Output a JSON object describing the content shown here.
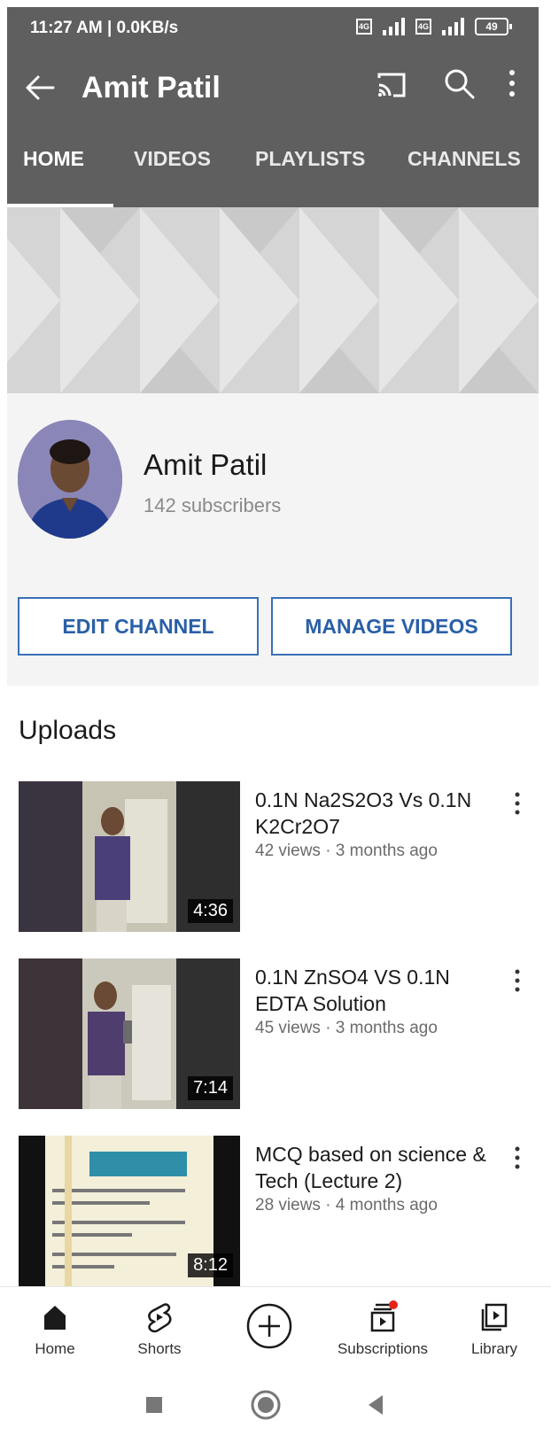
{
  "status_bar": {
    "time": "11:27 AM | 0.0KB/s",
    "battery": "49",
    "sim_label": "4G"
  },
  "app_bar": {
    "title": "Amit Patil",
    "tabs": [
      {
        "label": "HOME",
        "active": true
      },
      {
        "label": "VIDEOS",
        "active": false
      },
      {
        "label": "PLAYLISTS",
        "active": false
      },
      {
        "label": "CHANNELS",
        "active": false
      }
    ],
    "icons": [
      "back-arrow-icon",
      "cast-icon",
      "search-icon",
      "more-vertical-icon"
    ]
  },
  "channel": {
    "name": "Amit Patil",
    "subscribers": "142 subscribers",
    "edit_button": "EDIT CHANNEL",
    "manage_button": "MANAGE VIDEOS"
  },
  "uploads": {
    "title": "Uploads",
    "videos": [
      {
        "title": "0.1N Na2S2O3  Vs  0.1N K2Cr2O7",
        "meta": "42 views · 3 months ago",
        "duration": "4:36"
      },
      {
        "title": "0.1N ZnSO4 VS 0.1N EDTA Solution",
        "meta": "45 views · 3 months ago",
        "duration": "7:14"
      },
      {
        "title": "MCQ based on science & Tech (Lecture 2)",
        "meta": "28 views · 4 months ago",
        "duration": "8:12"
      }
    ]
  },
  "bottom_nav": {
    "items": [
      {
        "label": "Home",
        "icon": "home-icon"
      },
      {
        "label": "Shorts",
        "icon": "shorts-icon"
      },
      {
        "label": "",
        "icon": "create-plus-icon"
      },
      {
        "label": "Subscriptions",
        "icon": "subscriptions-icon"
      },
      {
        "label": "Library",
        "icon": "library-icon"
      }
    ]
  },
  "colors": {
    "header_bg": "#5f5f5f",
    "accent_blue": "#2a5fa8",
    "notification_red": "#e62117"
  }
}
